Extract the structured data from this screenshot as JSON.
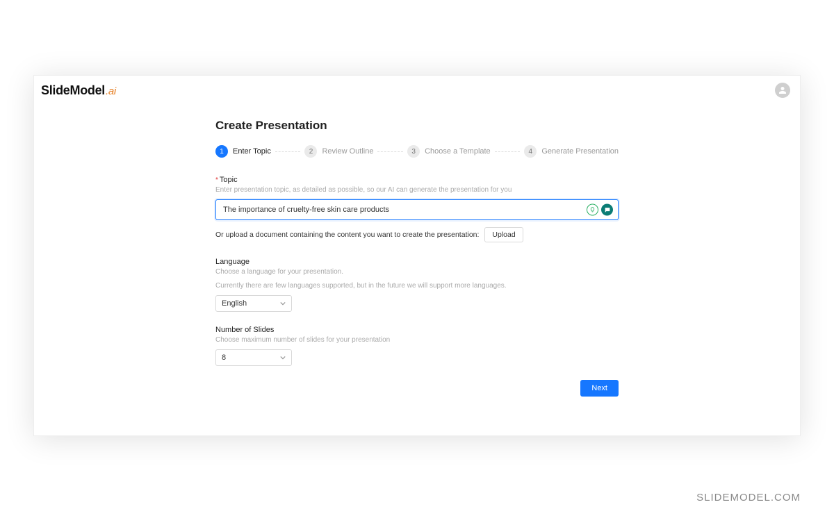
{
  "brand": {
    "name": "SlideModel",
    "suffix": ".ai"
  },
  "page": {
    "title": "Create Presentation"
  },
  "stepper": {
    "items": [
      {
        "num": "1",
        "label": "Enter Topic",
        "active": true
      },
      {
        "num": "2",
        "label": "Review Outline",
        "active": false
      },
      {
        "num": "3",
        "label": "Choose a Template",
        "active": false
      },
      {
        "num": "4",
        "label": "Generate Presentation",
        "active": false
      }
    ]
  },
  "topic": {
    "label": "Topic",
    "hint": "Enter presentation topic, as detailed as possible, so our AI can generate the presentation for you",
    "value": "The importance of cruelty-free skin care products"
  },
  "upload": {
    "text": "Or upload a document containing the content you want to create the presentation:",
    "button": "Upload"
  },
  "language": {
    "label": "Language",
    "hint1": "Choose a language for your presentation.",
    "hint2": "Currently there are few languages supported, but in the future we will support more languages.",
    "value": "English"
  },
  "slides": {
    "label": "Number of Slides",
    "hint": "Choose maximum number of slides for your presentation",
    "value": "8"
  },
  "actions": {
    "next": "Next"
  },
  "watermark": "SLIDEMODEL.COM"
}
